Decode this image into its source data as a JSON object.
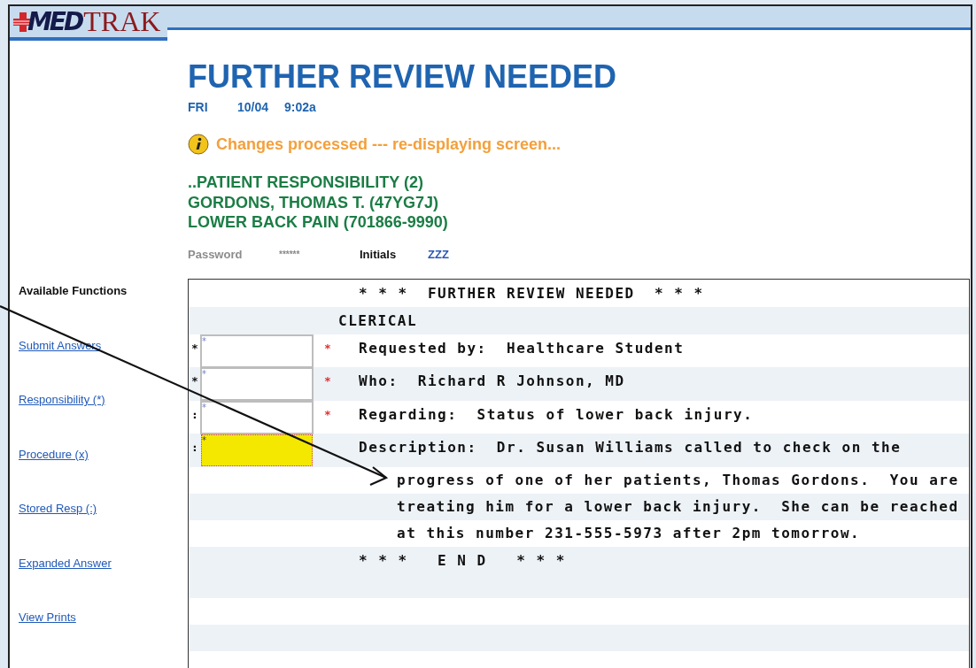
{
  "logo": {
    "mark": "MED",
    "name": "TRAK"
  },
  "page": {
    "title": "FURTHER REVIEW NEEDED",
    "day": "FRI",
    "date": "10/04",
    "time": "9:02a"
  },
  "message": {
    "kind": "info",
    "text": "Changes processed --- re-displaying screen..."
  },
  "context_lines": [
    "..PATIENT RESPONSIBILITY (2)",
    "GORDONS, THOMAS T. (47YG7J)",
    "LOWER BACK PAIN (701866-9990)"
  ],
  "credentials": {
    "password_label": "Password",
    "password_value": "******",
    "initials_label": "Initials",
    "initials_value": "ZZZ"
  },
  "sidebar": {
    "heading": "Available Functions",
    "links": [
      "Submit Answers",
      "Responsibility (*)",
      "Procedure (x)",
      "Stored Resp (:)",
      "Expanded Answer",
      "View Prints"
    ]
  },
  "terminal": {
    "rows": [
      {
        "kind": "banner",
        "text": "* * *  FURTHER REVIEW NEEDED  * * *"
      },
      {
        "kind": "section",
        "text": "CLERICAL"
      },
      {
        "kind": "field",
        "prefix": "*",
        "value": "*",
        "required": true,
        "focused": false,
        "text": "Requested by:  Healthcare Student"
      },
      {
        "kind": "field",
        "prefix": "*",
        "value": "*",
        "required": true,
        "focused": false,
        "text": "Who:  Richard R Johnson, MD"
      },
      {
        "kind": "field",
        "prefix": ":",
        "value": "*",
        "required": true,
        "focused": false,
        "text": "Regarding:  Status of lower back injury."
      },
      {
        "kind": "field",
        "prefix": ":",
        "value": "*",
        "required": false,
        "focused": true,
        "text": "Description:  Dr. Susan Williams called to check on the"
      },
      {
        "kind": "continuation",
        "text": "progress of one of her patients, Thomas Gordons.  You are"
      },
      {
        "kind": "continuation",
        "text": "treating him for a lower back injury.  She can be reached"
      },
      {
        "kind": "continuation",
        "text": "at this number 231-555-5973 after 2pm tomorrow."
      },
      {
        "kind": "banner",
        "text": "* * *   E N D   * * *"
      }
    ]
  }
}
